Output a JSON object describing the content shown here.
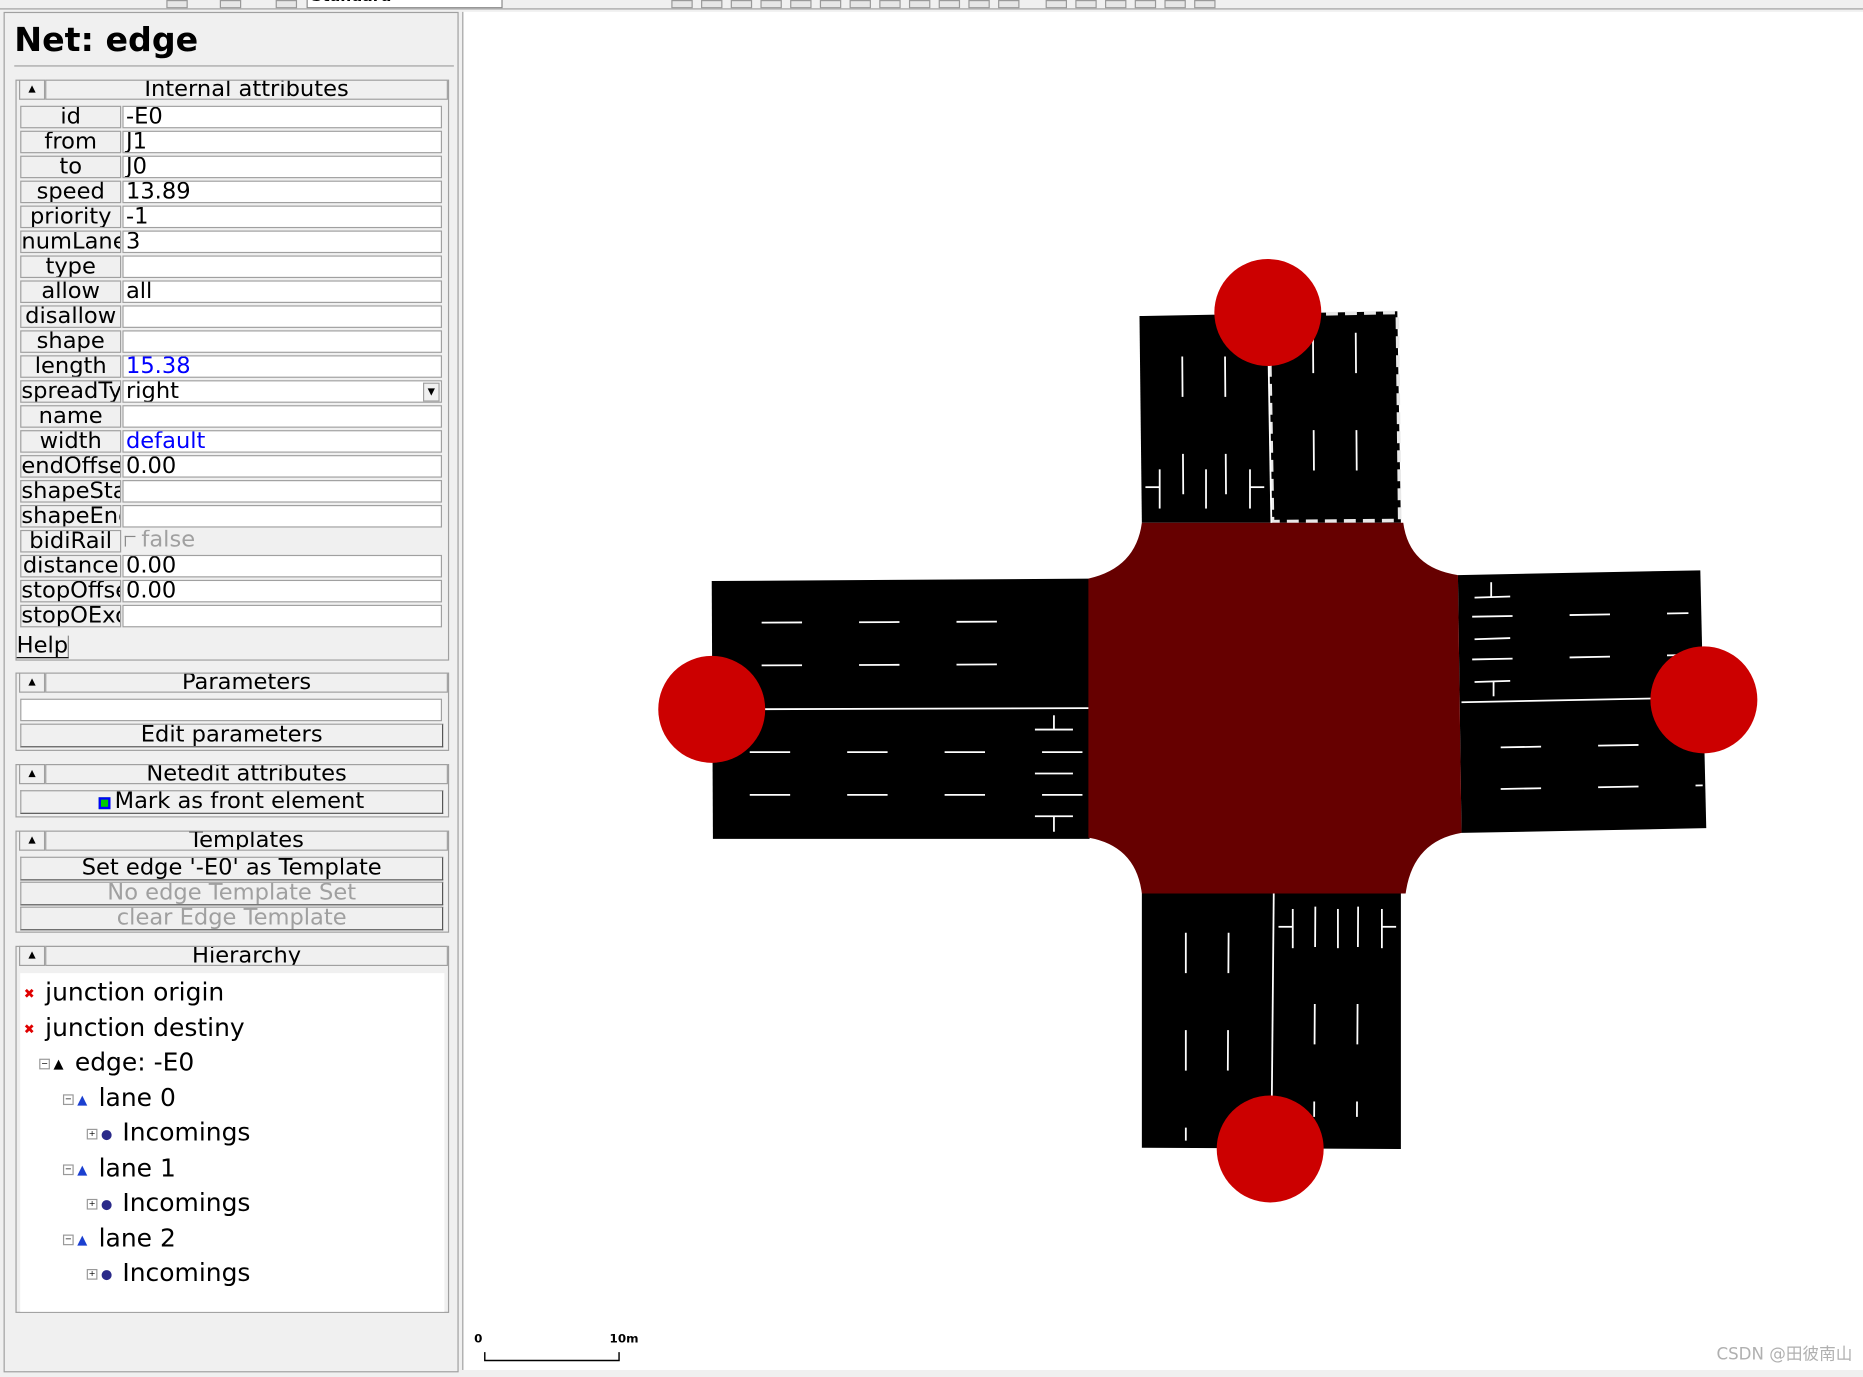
{
  "toolbar": {
    "mode_combo": "Standard"
  },
  "panel": {
    "title": "Net: edge",
    "internal": {
      "header": "Internal attributes",
      "attributes": [
        {
          "label": "id",
          "value": "-E0"
        },
        {
          "label": "from",
          "value": "J1"
        },
        {
          "label": "to",
          "value": "J0"
        },
        {
          "label": "speed",
          "value": "13.89"
        },
        {
          "label": "priority",
          "value": "-1"
        },
        {
          "label": "numLanes",
          "value": "3"
        },
        {
          "label": "type",
          "value": ""
        },
        {
          "label": "allow",
          "value": "all"
        },
        {
          "label": "disallow",
          "value": ""
        },
        {
          "label": "shape",
          "value": ""
        },
        {
          "label": "length",
          "value": "15.38",
          "color": "#0000ff"
        },
        {
          "label": "spreadType",
          "value": "right"
        },
        {
          "label": "name",
          "value": ""
        },
        {
          "label": "width",
          "value": "default",
          "color": "#0000ff"
        },
        {
          "label": "endOffset",
          "value": "0.00"
        },
        {
          "label": "shapeStart",
          "value": ""
        },
        {
          "label": "shapeEnd",
          "value": ""
        },
        {
          "label": "bidiRail",
          "value": "false"
        },
        {
          "label": "distance",
          "value": "0.00"
        },
        {
          "label": "stopOffset",
          "value": "0.00"
        },
        {
          "label": "stopOException",
          "value": ""
        }
      ],
      "help": "Help"
    },
    "parameters": {
      "header": "Parameters",
      "value": "",
      "edit_button": "Edit parameters"
    },
    "netedit": {
      "header": "Netedit attributes",
      "front_button": "Mark as front element"
    },
    "templates": {
      "header": "Templates",
      "set_button": "Set edge '-E0' as Template",
      "no_template_button": "No edge Template Set",
      "clear_button": "clear Edge Template"
    },
    "hierarchy": {
      "header": "Hierarchy",
      "items": [
        {
          "label": "junction origin",
          "icon": "junction-icon",
          "level": 0
        },
        {
          "label": "junction destiny",
          "icon": "junction-icon",
          "level": 0
        },
        {
          "label": "edge: -E0",
          "icon": "edge-icon",
          "level": 1
        },
        {
          "label": "lane 0",
          "icon": "lane-icon",
          "level": 2
        },
        {
          "label": "Incomings",
          "icon": "connection-icon",
          "level": 3
        },
        {
          "label": "lane 1",
          "icon": "lane-icon",
          "level": 2
        },
        {
          "label": "Incomings",
          "icon": "connection-icon",
          "level": 3
        },
        {
          "label": "lane 2",
          "icon": "lane-icon",
          "level": 2
        },
        {
          "label": "Incomings",
          "icon": "connection-icon",
          "level": 3
        }
      ]
    }
  },
  "map": {
    "colors": {
      "road": "#000000",
      "junction": "#660000",
      "junction_marker": "#cc0000"
    },
    "scale_start": "0",
    "scale_end": "10m",
    "watermark": "CSDN @田彼南山"
  }
}
